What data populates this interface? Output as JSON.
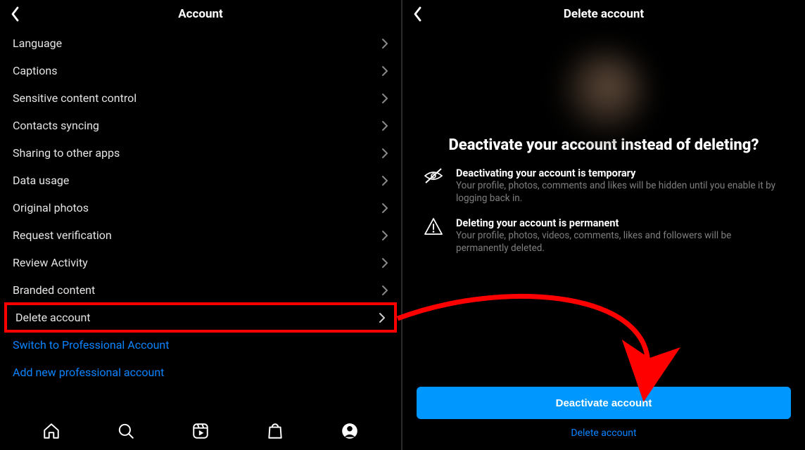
{
  "left": {
    "title": "Account",
    "items": [
      {
        "label": "Language"
      },
      {
        "label": "Captions"
      },
      {
        "label": "Sensitive content control"
      },
      {
        "label": "Contacts syncing"
      },
      {
        "label": "Sharing to other apps"
      },
      {
        "label": "Data usage"
      },
      {
        "label": "Original photos"
      },
      {
        "label": "Request verification"
      },
      {
        "label": "Review Activity"
      },
      {
        "label": "Branded content"
      },
      {
        "label": "Delete account"
      }
    ],
    "links": [
      "Switch to Professional Account",
      "Add new professional account"
    ]
  },
  "right": {
    "title": "Delete account",
    "headline": "Deactivate your account instead of deleting?",
    "info": [
      {
        "icon": "eye-slash-icon",
        "title": "Deactivating your account is temporary",
        "sub": "Your profile, photos, comments and likes will be hidden until you enable it by logging back in."
      },
      {
        "icon": "warning-triangle-icon",
        "title": "Deleting your account is permanent",
        "sub": "Your profile, photos, videos, comments, likes and followers will be permanently deleted."
      }
    ],
    "primary_button": "Deactivate account",
    "secondary_link": "Delete account"
  },
  "colors": {
    "accent_blue": "#0098fe",
    "link_blue": "#0a84ff",
    "annotation_red": "#ff0000"
  }
}
